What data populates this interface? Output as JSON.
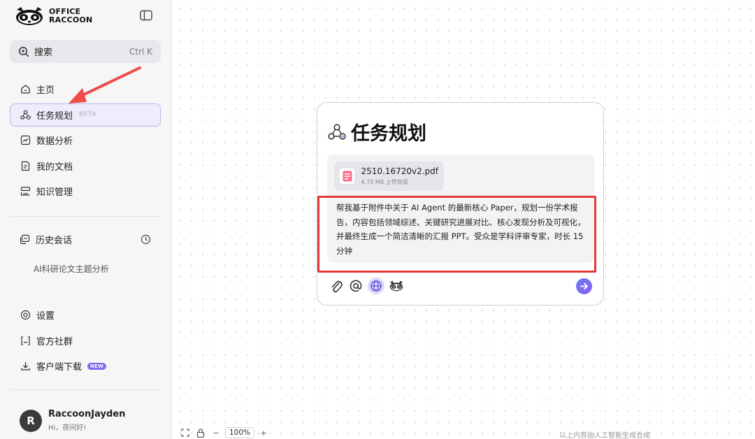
{
  "brand": {
    "line1": "OFFICE",
    "line2": "RACCOON"
  },
  "search": {
    "label": "搜索",
    "shortcut": "Ctrl K"
  },
  "nav": [
    {
      "label": "主页",
      "icon": "home-icon"
    },
    {
      "label": "任务规划",
      "icon": "task-planning-icon",
      "badge": "BETA",
      "active": true
    },
    {
      "label": "数据分析",
      "icon": "chart-icon"
    },
    {
      "label": "我的文档",
      "icon": "document-icon"
    },
    {
      "label": "知识管理",
      "icon": "knowledge-icon"
    }
  ],
  "history": {
    "label": "历史会话",
    "items": [
      "AI科研论文主题分析"
    ]
  },
  "bottom_nav": [
    {
      "label": "设置",
      "icon": "settings-icon"
    },
    {
      "label": "官方社群",
      "icon": "community-icon"
    },
    {
      "label": "客户端下载",
      "icon": "download-icon",
      "badge": "NEW"
    }
  ],
  "user": {
    "initial": "R",
    "name": "RaccoonJayden",
    "greeting": "Hi，夜间好!"
  },
  "card": {
    "title": "任务规划",
    "file": {
      "name": "2510.16720v2.pdf",
      "meta": "4.73 MB 上传完成"
    },
    "prompt": "帮我基于附件中关于 AI Agent 的最新核心 Paper，规划一份学术报告，内容包括领域综述、关键研究进展对比、核心发现分析及可视化，并最终生成一个简洁清晰的汇报 PPT。受众是学科评审专家，时长 15 分钟"
  },
  "zoom": {
    "level": "100%",
    "minus": "−",
    "plus": "+"
  },
  "footer_note": "以上内容由人工智能生成合成",
  "colors": {
    "accent": "#7b6cf0",
    "highlight": "#e53935",
    "active_bg": "#ededfb"
  }
}
